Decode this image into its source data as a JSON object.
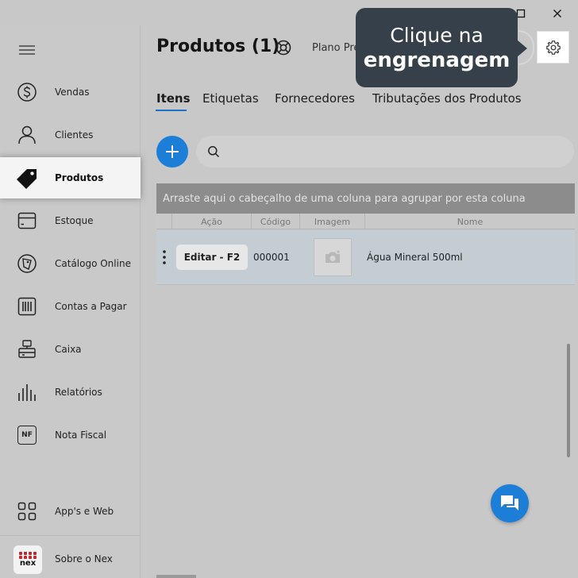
{
  "header": {
    "title": "Produtos (1)",
    "plan_text": "Plano Pre"
  },
  "tooltip": {
    "line1": "Clique na",
    "line2": "engrenagem"
  },
  "sidebar": {
    "items": [
      {
        "label": "Vendas",
        "icon": "dollar-circle-icon"
      },
      {
        "label": "Clientes",
        "icon": "user-icon"
      },
      {
        "label": "Produtos",
        "icon": "tag-icon",
        "active": true
      },
      {
        "label": "Estoque",
        "icon": "box-icon"
      },
      {
        "label": "Catálogo Online",
        "icon": "catalog-icon"
      },
      {
        "label": "Contas a Pagar",
        "icon": "barcode-icon"
      },
      {
        "label": "Caixa",
        "icon": "register-icon"
      },
      {
        "label": "Relatórios",
        "icon": "bar-chart-icon"
      },
      {
        "label": "Nota Fiscal",
        "icon": "nf-icon"
      }
    ],
    "bottom_items": [
      {
        "label": "App's e Web",
        "icon": "grid-icon"
      },
      {
        "label": "Sobre o Nex",
        "icon": "nex-logo"
      }
    ],
    "nf_icon_text": "NF",
    "logo_text": "nex"
  },
  "tabs": [
    {
      "label": "Itens",
      "active": true
    },
    {
      "label": "Etiquetas"
    },
    {
      "label": "Fornecedores"
    },
    {
      "label": "Tributações dos Produtos"
    }
  ],
  "search": {
    "placeholder": ""
  },
  "grid": {
    "group_bar_text": "Arraste aqui o cabeçalho de uma coluna para agrupar por esta coluna",
    "columns": [
      "Ação",
      "Código",
      "Imagem",
      "Nome"
    ],
    "rows": [
      {
        "action_label": "Editar - F2",
        "code": "000001",
        "name": "Água Mineral 500ml"
      }
    ]
  },
  "colors": {
    "accent": "#1c7ed6",
    "tooltip_bg": "#36404b",
    "row_selected": "#c4cdd4",
    "brand_red": "#c0282d"
  }
}
